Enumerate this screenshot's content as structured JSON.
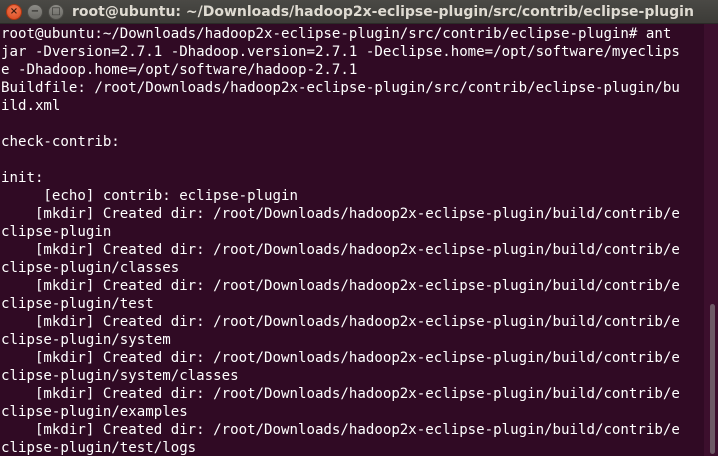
{
  "window": {
    "title": "root@ubuntu: ~/Downloads/hadoop2x-eclipse-plugin/src/contrib/eclipse-plugin",
    "close_glyph": "×",
    "minimize_glyph": "−",
    "maximize_glyph": "□"
  },
  "terminal": {
    "lines": [
      "root@ubuntu:~/Downloads/hadoop2x-eclipse-plugin/src/contrib/eclipse-plugin# ant",
      "jar -Dversion=2.7.1 -Dhadoop.version=2.7.1 -Declipse.home=/opt/software/myeclips",
      "e -Dhadoop.home=/opt/software/hadoop-2.7.1",
      "Buildfile: /root/Downloads/hadoop2x-eclipse-plugin/src/contrib/eclipse-plugin/bu",
      "ild.xml",
      "",
      "check-contrib:",
      "",
      "init:",
      "     [echo] contrib: eclipse-plugin",
      "    [mkdir] Created dir: /root/Downloads/hadoop2x-eclipse-plugin/build/contrib/e",
      "clipse-plugin",
      "    [mkdir] Created dir: /root/Downloads/hadoop2x-eclipse-plugin/build/contrib/e",
      "clipse-plugin/classes",
      "    [mkdir] Created dir: /root/Downloads/hadoop2x-eclipse-plugin/build/contrib/e",
      "clipse-plugin/test",
      "    [mkdir] Created dir: /root/Downloads/hadoop2x-eclipse-plugin/build/contrib/e",
      "clipse-plugin/system",
      "    [mkdir] Created dir: /root/Downloads/hadoop2x-eclipse-plugin/build/contrib/e",
      "clipse-plugin/system/classes",
      "    [mkdir] Created dir: /root/Downloads/hadoop2x-eclipse-plugin/build/contrib/e",
      "clipse-plugin/examples",
      "    [mkdir] Created dir: /root/Downloads/hadoop2x-eclipse-plugin/build/contrib/e",
      "clipse-plugin/test/logs"
    ]
  },
  "colors": {
    "background": "#300a24",
    "text": "#ffffff",
    "titlebar": "#3c3b37",
    "close_button": "#e9542a"
  }
}
